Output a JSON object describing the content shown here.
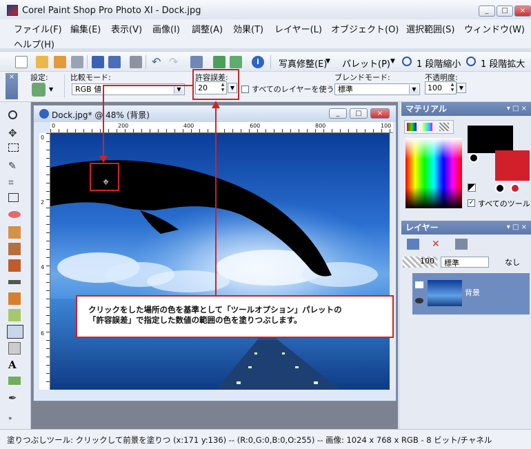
{
  "window": {
    "title": "Corel Paint Shop Pro Photo XI - Dock.jpg",
    "buttons": [
      "_",
      "□",
      "×"
    ]
  },
  "menu": {
    "items": [
      "ファイル(F)",
      "編集(E)",
      "表示(V)",
      "画像(I)",
      "調整(A)",
      "効果(T)",
      "レイヤー(L)",
      "オブジェクト(O)",
      "選択範囲(S)",
      "ウィンドウ(W)",
      "ヘルプ(H)"
    ]
  },
  "toolbar": {
    "photo_fix": "写真修整(E)",
    "palette": "パレット(P)",
    "zoom_out": "1 段階縮小",
    "zoom_in": "1 段階拡大"
  },
  "tool_options": {
    "preset_label": "設定:",
    "compare_mode_label": "比較モード:",
    "compare_mode_value": "RGB 値",
    "tolerance_label": "許容誤差:",
    "tolerance_value": "20",
    "all_layers_label": "すべてのレイヤーを使う",
    "blend_mode_label": "ブレンドモード:",
    "blend_mode_value": "標準",
    "opacity_label": "不透明度:",
    "opacity_value": "100"
  },
  "document": {
    "title": "Dock.jpg* @  48% (背景)",
    "ruler_h": [
      "0",
      "200",
      "400",
      "600",
      "800",
      "100"
    ],
    "ruler_v": [
      "0",
      "2",
      "4",
      "6"
    ]
  },
  "materials": {
    "title": "マテリアル",
    "all_tools_label": "すべてのツール"
  },
  "layers": {
    "title": "レイヤー",
    "opacity_value": "100",
    "blend_value": "標準",
    "lock_value": "なし",
    "layer_name": "背景"
  },
  "status": {
    "text": "塗りつぶしツール: クリックして前景を塗りつ   (x:171 y:136) -- (R:0,G:0,B:0,O:255) -- 画像:  1024 x 768 x RGB - 8 ビット/チャネル"
  },
  "annotation": {
    "line1": "クリックをした場所の色を基準として「ツールオプション」パレットの",
    "line2": "「許容誤差」で指定した数値の範囲の色を塗りつぶします。"
  },
  "colors": {
    "accent_red": "#d62020",
    "panel_title": "#5c78ab",
    "foreground": "#000000",
    "background": "#d0202a"
  }
}
